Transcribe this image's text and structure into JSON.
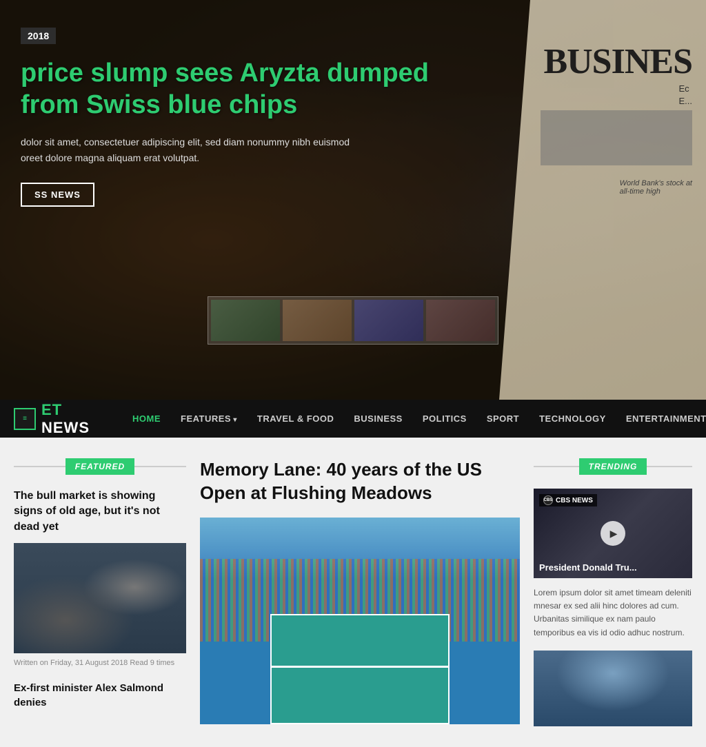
{
  "hero": {
    "date": "2018",
    "title": "price slump sees Aryzta dumped from Swiss blue chips",
    "excerpt_line1": "dolor sit amet, consectetuer adipiscing elit, sed diam nonummy nibh euismod",
    "excerpt_line2": "oreet dolore magna aliquam erat volutpat.",
    "button_label": "SS NEWS",
    "newspaper_title": "BUSINES",
    "newspaper_sub1": "Ec",
    "newspaper_sub2": "E...",
    "newspaper_bank": "World Bank's stock at",
    "newspaper_bank2": "all-time high"
  },
  "navbar": {
    "logo_icon_text": "≡",
    "logo_text": "ET NEWS",
    "logo_et": "ET",
    "items": [
      {
        "label": "HOME",
        "active": true
      },
      {
        "label": "FEATURES",
        "dropdown": true
      },
      {
        "label": "TRAVEL & FOOD"
      },
      {
        "label": "BUSINESS"
      },
      {
        "label": "POLITICS"
      },
      {
        "label": "SPORT"
      },
      {
        "label": "TECHNOLOGY"
      },
      {
        "label": "ENTERTAINMENT"
      }
    ]
  },
  "featured": {
    "badge": "FEATURED",
    "article1_title": "The bull market is showing signs of old age, but it's not dead yet",
    "article1_meta": "Written on Friday, 31 August 2018 Read 9 times",
    "article2_title": "Ex-first minister Alex Salmond denies"
  },
  "main_article": {
    "title": "Memory Lane: 40 years of the US Open at Flushing Meadows"
  },
  "trending": {
    "badge": "TRENDING",
    "video_label": "CBS NEWS",
    "video_title": "President Donald Tru...",
    "video_desc": "Lorem ipsum dolor sit amet timeam deleniti mnesar ex sed alii hinc dolores ad cum. Urbanitas similique ex nam paulo temporibus ea vis id odio adhuc nostrum."
  }
}
